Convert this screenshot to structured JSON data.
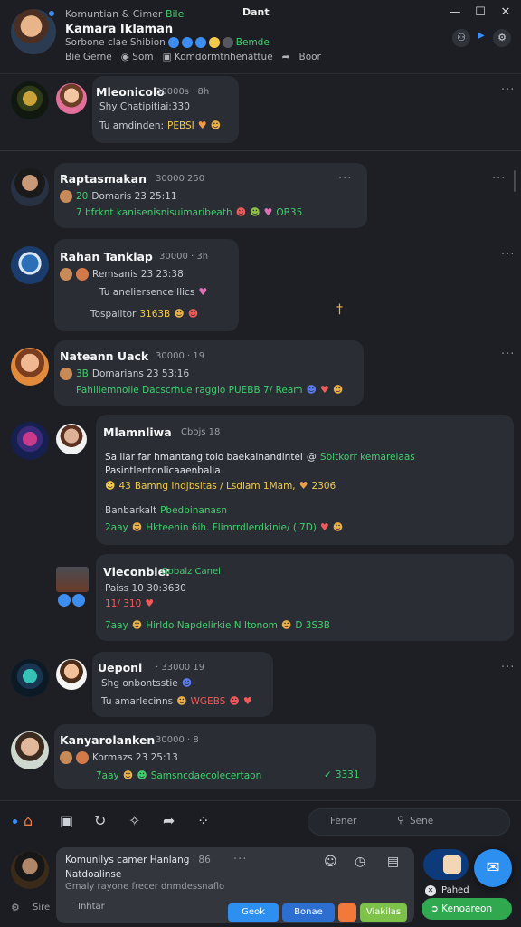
{
  "window": {
    "title": "Dant",
    "controls": [
      "—",
      "☐",
      "✕"
    ]
  },
  "header": {
    "line1": "Komuntian & Cimer",
    "line1_accent": "Bile",
    "name": "Kamara Iklaman",
    "line3": "Sorbone clae Shibion",
    "line3_tag": "Bemde",
    "links": [
      "Bie Gerne",
      "Som",
      "Komdormtnhenattue",
      "Boor"
    ]
  },
  "feed": [
    {
      "name": "Mleonicolo",
      "meta": "30000s · 8h",
      "line1": "Shy Chatipitiai:330",
      "line2_label": "Tu amdinden:",
      "line2_value": "PEBSI"
    },
    {
      "name": "Raptasmakan",
      "meta": "30000 250",
      "line1_label": "20",
      "line1": "Domaris 23 25:11",
      "line2": "7 bfrknt kanisenisnisuimaribeath",
      "line2_value": "OB35"
    },
    {
      "name": "Rahan Tanklap",
      "meta": "30000 · 3h",
      "line1": "Remsanis 23 23:38",
      "line2": "Tu aneliersence Ilics",
      "line3_label": "Tospalitor",
      "line3_value": "3163B"
    },
    {
      "name": "Nateann Uack",
      "meta": "30000 · 19",
      "line1_label": "3B",
      "line1": "Domarians 23 53:16",
      "line2": "Pahlilemnolie Dacscrhue raggio PUEBB 7/ Ream"
    },
    {
      "name": "Mlamnliwa",
      "meta": "Cbojs 18",
      "line1": "Sa liar far hmantang tolo baekalnandintel",
      "line1_tag": "Sbitkorr kemareiaas",
      "line2": "Pasintlentonlicaaenbalia",
      "line3_label": "43",
      "line3": "Bamng Indjbsitas / Lsdiam 1Mam,",
      "line3_value": "2306",
      "line4_label": "Banbarkalt",
      "line4_value": "Pbedbinanasn",
      "line5_label": "2aay",
      "line5": "Hkteenin 6ih. Flimrrdlerdkinie/ (I7D)"
    },
    {
      "name": "Vleconble:",
      "meta": "Gobalz Canel",
      "line1": "Paiss 10 30:3630",
      "line2": "11/ 310",
      "line3_label": "7aay",
      "line3": "Hirldo Napdelirkie N Itonom",
      "line3_value": "D 3S3B"
    },
    {
      "name": "Ueponl",
      "meta": "· 33000 19",
      "line1": "Shg onbontsstie",
      "line2_label": "Tu amarlecinns",
      "line2_value": "WGEBS"
    },
    {
      "name": "Kanyarolanken",
      "meta": "30000 · 8",
      "line1": "Kormazs 23 25:13",
      "line2_label": "7aay",
      "line2": "Samsncdaecolecertaon",
      "line2_value": "3331"
    }
  ],
  "nav": {
    "search_left": "Fener",
    "search_right": "Sene"
  },
  "composer": {
    "line1": "Komunilys camer Hanlang",
    "line1_meta": "· 86",
    "line2": "Natdoalinse",
    "line3": "Gmaly rayone  frecer dnmdessnaflo",
    "footer_left": "Sire",
    "footer_tag": "Inhtar",
    "pills": [
      "Geok",
      "Bonae",
      "",
      "Viakilas"
    ],
    "right_label": "Pahed",
    "right_button": "Kenoareon"
  }
}
